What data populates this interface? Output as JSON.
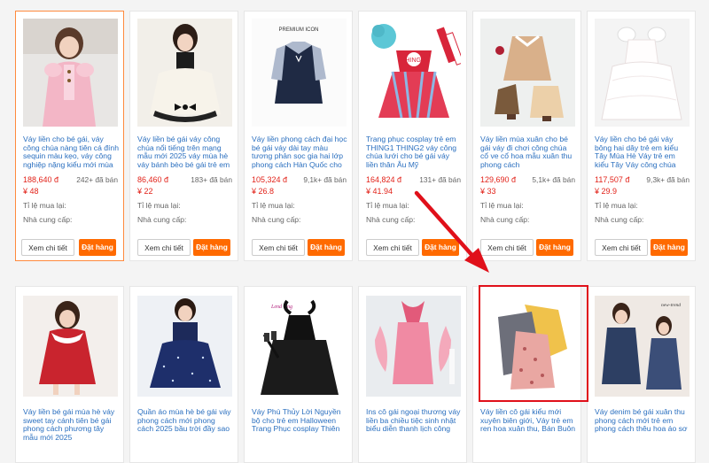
{
  "products_row1": [
    {
      "title": "Váy liền cho bé gái, váy công chúa nàng tiên cá đính sequin màu kẹo, váy công nghiệp nặng kiểu mới mùa hè",
      "price_vnd": "188,640 đ",
      "sold": "242+ đã bán",
      "price_cny": "¥ 48",
      "repurchase_label": "Tỉ lệ mua lại:",
      "supplier_label": "Nhà cung cấp:",
      "detail_btn": "Xem chi tiết",
      "order_btn": "Đặt hàng"
    },
    {
      "title": "Váy liền bé gái váy công chúa nổi tiếng trên mạng mẫu mới 2025 váy mùa hè váy bánh bèo bé gái trẻ em",
      "price_vnd": "86,460 đ",
      "sold": "183+ đã bán",
      "price_cny": "¥ 22",
      "repurchase_label": "Tỉ lệ mua lại:",
      "supplier_label": "Nhà cung cấp:",
      "detail_btn": "Xem chi tiết",
      "order_btn": "Đặt hàng"
    },
    {
      "title": "Váy liền phong cách đại học bé gái váy dài tay màu tương phản sọc gia hai lớp phong cách Hàn Quốc cho",
      "price_vnd": "105,324 đ",
      "sold": "9,1k+ đã bán",
      "price_cny": "¥ 26.8",
      "repurchase_label": "Tỉ lệ mua lại:",
      "supplier_label": "Nhà cung cấp:",
      "detail_btn": "Xem chi tiết",
      "order_btn": "Đặt hàng"
    },
    {
      "title": "Trang phục cosplay trẻ em THING1 THING2 váy công chúa lưới cho bé gái váy liền thân Âu Mỹ",
      "price_vnd": "164,824 đ",
      "sold": "131+ đã bán",
      "price_cny": "¥ 41.94",
      "repurchase_label": "Tỉ lệ mua lại:",
      "supplier_label": "Nhà cung cấp:",
      "detail_btn": "Xem chi tiết",
      "order_btn": "Đặt hàng"
    },
    {
      "title": "Váy liền mùa xuân cho bé gái váy đi chơi công chúa cổ ve cổ hoa mẫu xuân thu phong cách",
      "price_vnd": "129,690 đ",
      "sold": "5,1k+ đã bán",
      "price_cny": "¥ 33",
      "repurchase_label": "Tỉ lệ mua lại:",
      "supplier_label": "Nhà cung cấp:",
      "detail_btn": "Xem chi tiết",
      "order_btn": "Đặt hàng"
    },
    {
      "title": "Váy liền cho bé gái váy bông hai dây trẻ em kiểu Tây Mùa Hè Váy trẻ em kiểu Tây Váy công chúa lưới cho bé",
      "price_vnd": "117,507 đ",
      "sold": "9,3k+ đã bán",
      "price_cny": "¥ 29.9",
      "repurchase_label": "Tỉ lệ mua lại:",
      "supplier_label": "Nhà cung cấp:",
      "detail_btn": "Xem chi tiết",
      "order_btn": "Đặt hàng"
    }
  ],
  "products_row2": [
    {
      "title": "Váy liền bé gái mùa hè váy sweet tay cánh tiên bé gái phong cách phương tây mẫu mới 2025"
    },
    {
      "title": "Quần áo mùa hè bé gái váy phong cách mới phong cách 2025 bầu trời đầy sao"
    },
    {
      "title": "Váy Phù Thủy Lời Nguyền bộ cho trẻ em Halloween Trang Phục cosplay Thiên"
    },
    {
      "title": "Ins cô gái ngoại thương váy liền ba chiều tiệc sinh nhật biểu diễn thanh lịch công"
    },
    {
      "title": "Váy liền cô gái kiểu mới xuyên biên giới, Váy trẻ em ren hoa xuân thu, Bán Buôn"
    },
    {
      "title": "Váy denim bé gái xuân thu phong cách mới trẻ em phong cách thêu hoa áo sơ"
    }
  ],
  "image_text": {
    "premium": "PREMIUM   ICON",
    "thing_badge": "THING 2",
    "brand_a": "new-trend",
    "brand_b": "Lend Ying"
  },
  "colors": {
    "accent": "#ff6a00",
    "link": "#2a6fbf",
    "price": "#e2231a",
    "highlight": "#e0101a"
  }
}
